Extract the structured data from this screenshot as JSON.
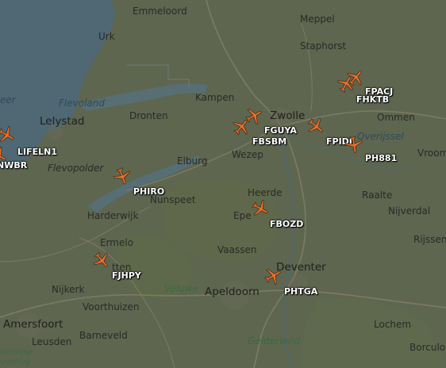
{
  "map": {
    "places": {
      "emmeloord": "Emmeloord",
      "meppel": "Meppel",
      "urk": "Urk",
      "staphorst": "Staphorst",
      "lelystad": "Lelystad",
      "dronten": "Dronten",
      "kampen": "Kampen",
      "zwolle": "Zwolle",
      "ommen": "Ommen",
      "vroomshoop": "Vroom",
      "elburg": "Elburg",
      "wezep": "Wezep",
      "nunspeet": "Nunspeet",
      "heerde": "Heerde",
      "raalte": "Raalte",
      "harderwijk": "Harderwijk",
      "epe": "Epe",
      "nijverdal": "Nijverdal",
      "ermelo": "Ermelo",
      "rijssen": "Rijssen",
      "putten": "tten",
      "vaassen": "Vaassen",
      "nijkerk": "Nijkerk",
      "deventer": "Deventer",
      "voorthuizen": "Voorthuizen",
      "apeldoorn": "Apeldoorn",
      "amersfoort": "Amersfoort",
      "barneveld": "Barneveld",
      "lochem": "Lochem",
      "leusden": "Leusden",
      "borculo": "Borculo",
      "eer": "eer"
    },
    "water_labels": {
      "flevoland": "Flevoland",
      "overijssel": "Overijssel"
    },
    "regions": {
      "flevopolder": "Flevopolder",
      "veluwe": "Veluwe",
      "gelderland": "Gelderland",
      "utrecht": "trechtse",
      "heuvelrug": "uvelrug"
    },
    "aircraft": [
      {
        "callsign": "LIFELN1",
        "heading": 120
      },
      {
        "callsign": "NWBR",
        "heading": 120
      },
      {
        "callsign": "PHIRO",
        "heading": 160
      },
      {
        "callsign": "FGUYA",
        "heading": 60
      },
      {
        "callsign": "FBSBM",
        "heading": 40
      },
      {
        "callsign": "FPIDI",
        "heading": 130
      },
      {
        "callsign": "PH881",
        "heading": 170
      },
      {
        "callsign": "FPACJ",
        "heading": 40
      },
      {
        "callsign": "FHKTB",
        "heading": 30
      },
      {
        "callsign": "FBOZD",
        "heading": 120
      },
      {
        "callsign": "FJHPY",
        "heading": 140
      },
      {
        "callsign": "PHTGA",
        "heading": 60
      }
    ],
    "colors": {
      "land": "#5e6650",
      "water": "#4f6873",
      "lake": "#55707a",
      "plane": "#e8702a",
      "road": "#8a8468",
      "label": "#ffffff"
    }
  }
}
